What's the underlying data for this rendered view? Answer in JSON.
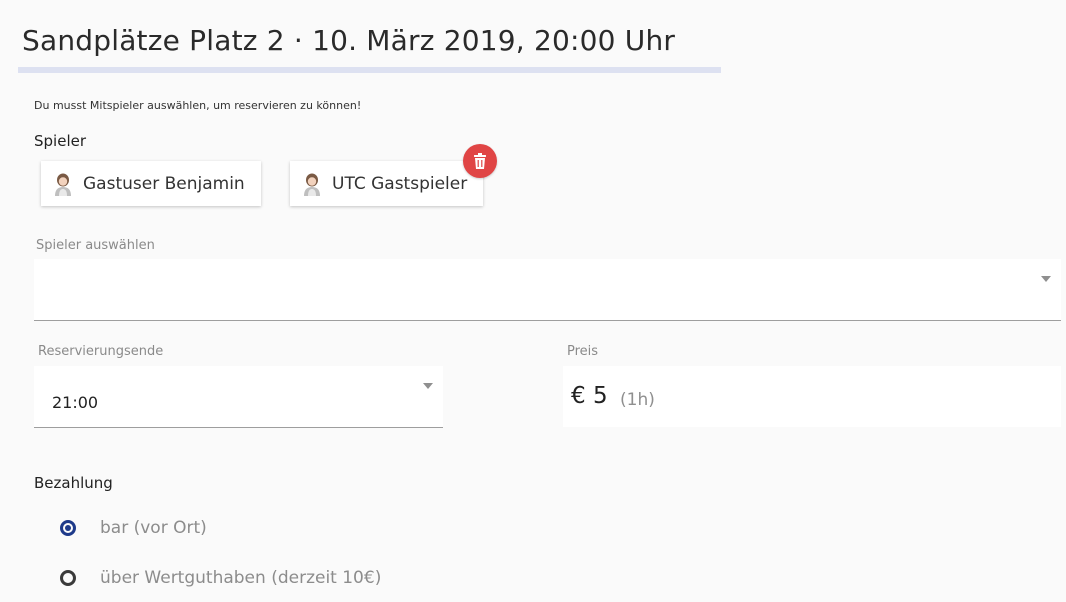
{
  "header": {
    "title": "Sandplätze Platz 2 · 10. März 2019, 20:00 Uhr"
  },
  "hint": "Du musst Mitspieler auswählen, um reservieren zu können!",
  "players": {
    "label": "Spieler",
    "chips": [
      {
        "name": "Gastuser Benjamin",
        "icon": "player-avatar-icon"
      },
      {
        "name": "UTC Gastspieler",
        "icon": "player-avatar-icon",
        "delete_icon": "trash-icon"
      }
    ],
    "select_label": "Spieler auswählen",
    "select_value": ""
  },
  "reservation_end": {
    "label": "Reservierungsende",
    "value": "21:00"
  },
  "price": {
    "label": "Preis",
    "amount": "€ 5",
    "duration": "(1h)"
  },
  "payment": {
    "label": "Bezahlung",
    "options": [
      {
        "label": "bar (vor Ort)",
        "checked": true
      },
      {
        "label": "über Wertguthaben (derzeit 10€)",
        "checked": false
      }
    ]
  },
  "colors": {
    "accent": "#1e3a8a",
    "delete": "#e04545",
    "underline": "#dde1f1"
  }
}
